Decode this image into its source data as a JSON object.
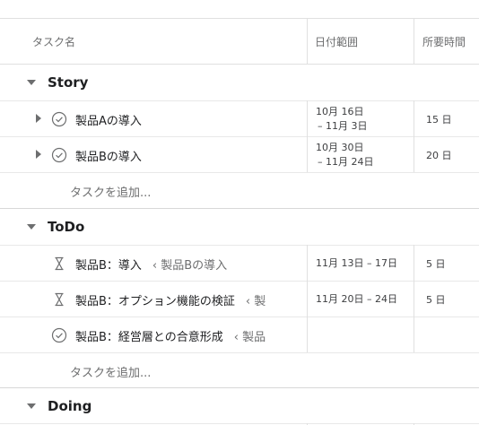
{
  "columns": {
    "task_name": "タスク名",
    "date_range": "日付範囲",
    "duration": "所要時間"
  },
  "add_task_label": "タスクを追加...",
  "sections": [
    {
      "title": "Story",
      "rows": [
        {
          "name": "製品Aの導入",
          "parent": "",
          "status": "check-circle-icon",
          "has_subtasks": true,
          "date_line1": "10月 16日",
          "date_line2": "– 11月 3日",
          "duration": "15 日"
        },
        {
          "name": "製品Bの導入",
          "parent": "",
          "status": "check-circle-icon",
          "has_subtasks": true,
          "date_line1": "10月 30日",
          "date_line2": "– 11月 24日",
          "duration": "20 日"
        }
      ]
    },
    {
      "title": "ToDo",
      "rows": [
        {
          "name": "製品B：導入",
          "parent": "‹ 製品Bの導入",
          "status": "hourglass-icon",
          "has_subtasks": false,
          "date_line1": "11月 13日 – 17日",
          "date_line2": "",
          "duration": "5 日"
        },
        {
          "name": "製品B：オプション機能の検証",
          "parent": "‹ 製",
          "status": "hourglass-icon",
          "has_subtasks": false,
          "date_line1": "11月 20日 – 24日",
          "date_line2": "",
          "duration": "5 日"
        },
        {
          "name": "製品B：経営層との合意形成",
          "parent": "‹ 製品",
          "status": "check-circle-icon",
          "has_subtasks": false,
          "date_line1": "",
          "date_line2": "",
          "duration": ""
        }
      ]
    },
    {
      "title": "Doing",
      "rows": []
    }
  ]
}
